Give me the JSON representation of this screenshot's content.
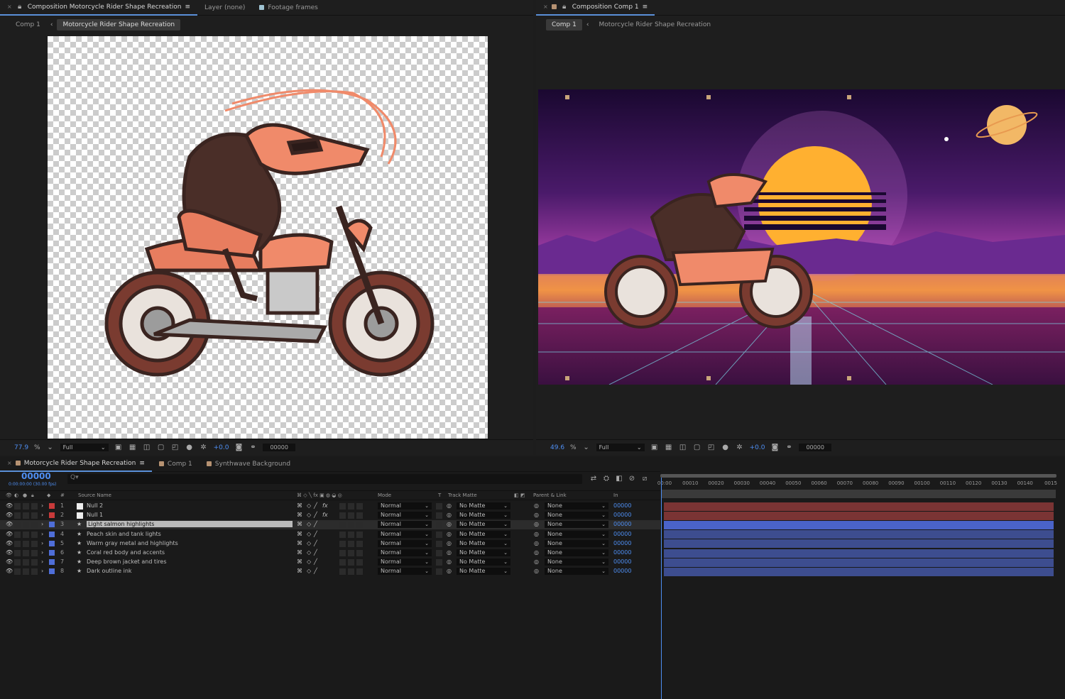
{
  "left_panel": {
    "tabs": [
      {
        "close": "×",
        "label": "Composition Motorcycle Rider Shape Recreation",
        "menu": "≡"
      },
      {
        "label": "Layer (none)"
      },
      {
        "label": "Footage frames"
      }
    ],
    "breadcrumbs": [
      "Comp 1",
      "Motorcycle Rider Shape Recreation"
    ],
    "footer": {
      "zoom": "77.9",
      "zoom_unit": "%",
      "resolution": "Full",
      "exposure": "+0.0",
      "timecode": "00000"
    }
  },
  "right_panel": {
    "tabs": [
      {
        "close": "×",
        "label": "Composition Comp 1",
        "menu": "≡"
      }
    ],
    "breadcrumbs": [
      "Comp 1",
      "Motorcycle Rider Shape Recreation"
    ],
    "footer": {
      "zoom": "49.6",
      "zoom_unit": "%",
      "resolution": "Full",
      "exposure": "+0.0",
      "timecode": "00000"
    }
  },
  "timeline": {
    "tabs": [
      {
        "close": "×",
        "label": "Motorcycle Rider Shape Recreation",
        "menu": "≡"
      },
      {
        "label": "Comp 1"
      },
      {
        "label": "Synthwave Background"
      }
    ],
    "current_time": "00000",
    "current_time_sub": "0:00:00:00 (30.00 fps)",
    "search_icon_text": "Q▾",
    "columns": {
      "hash": "#",
      "source_name": "Source Name",
      "mode": "Mode",
      "t": "T",
      "track_matte": "Track Matte",
      "parent_link": "Parent & Link",
      "in": "In"
    },
    "layers": [
      {
        "num": "1",
        "name": "Null 2",
        "color": "#c83a3a",
        "kind": "null",
        "mode": "Normal",
        "matte": "No Matte",
        "parent": "None",
        "in": "00000",
        "bar": "#7a3434",
        "fx": true
      },
      {
        "num": "2",
        "name": "Null 1",
        "color": "#c83a3a",
        "kind": "null",
        "mode": "Normal",
        "matte": "No Matte",
        "parent": "None",
        "in": "00000",
        "bar": "#7a3434",
        "fx": true
      },
      {
        "num": "3",
        "name": "Light salmon highlights",
        "color": "#4f6ed8",
        "kind": "shape",
        "mode": "Normal",
        "matte": "No Matte",
        "parent": "None",
        "in": "00000",
        "bar": "#4a63c8",
        "selected": true
      },
      {
        "num": "4",
        "name": "Peach skin and tank lights",
        "color": "#4f6ed8",
        "kind": "shape",
        "mode": "Normal",
        "matte": "No Matte",
        "parent": "None",
        "in": "00000",
        "bar": "#3d4d8f"
      },
      {
        "num": "5",
        "name": "Warm gray metal and highlights",
        "color": "#4f6ed8",
        "kind": "shape",
        "mode": "Normal",
        "matte": "No Matte",
        "parent": "None",
        "in": "00000",
        "bar": "#3d4d8f"
      },
      {
        "num": "6",
        "name": "Coral red body and accents",
        "color": "#4f6ed8",
        "kind": "shape",
        "mode": "Normal",
        "matte": "No Matte",
        "parent": "None",
        "in": "00000",
        "bar": "#3d4d8f"
      },
      {
        "num": "7",
        "name": "Deep brown jacket and tires",
        "color": "#4f6ed8",
        "kind": "shape",
        "mode": "Normal",
        "matte": "No Matte",
        "parent": "None",
        "in": "00000",
        "bar": "#3d4d8f"
      },
      {
        "num": "8",
        "name": "Dark outline ink",
        "color": "#4f6ed8",
        "kind": "shape",
        "mode": "Normal",
        "matte": "No Matte",
        "parent": "None",
        "in": "00000",
        "bar": "#3d4d8f"
      }
    ],
    "ruler_ticks": [
      "00:00",
      "00010",
      "00020",
      "00030",
      "00040",
      "00050",
      "00060",
      "00070",
      "00080",
      "00090",
      "00100",
      "00110",
      "00120",
      "00130",
      "00140",
      "0015"
    ]
  },
  "colors": {
    "accent": "#4e8ef2",
    "panel": "#1e1e1e",
    "null_label": "#c83a3a",
    "shape_label": "#4f6ed8"
  }
}
